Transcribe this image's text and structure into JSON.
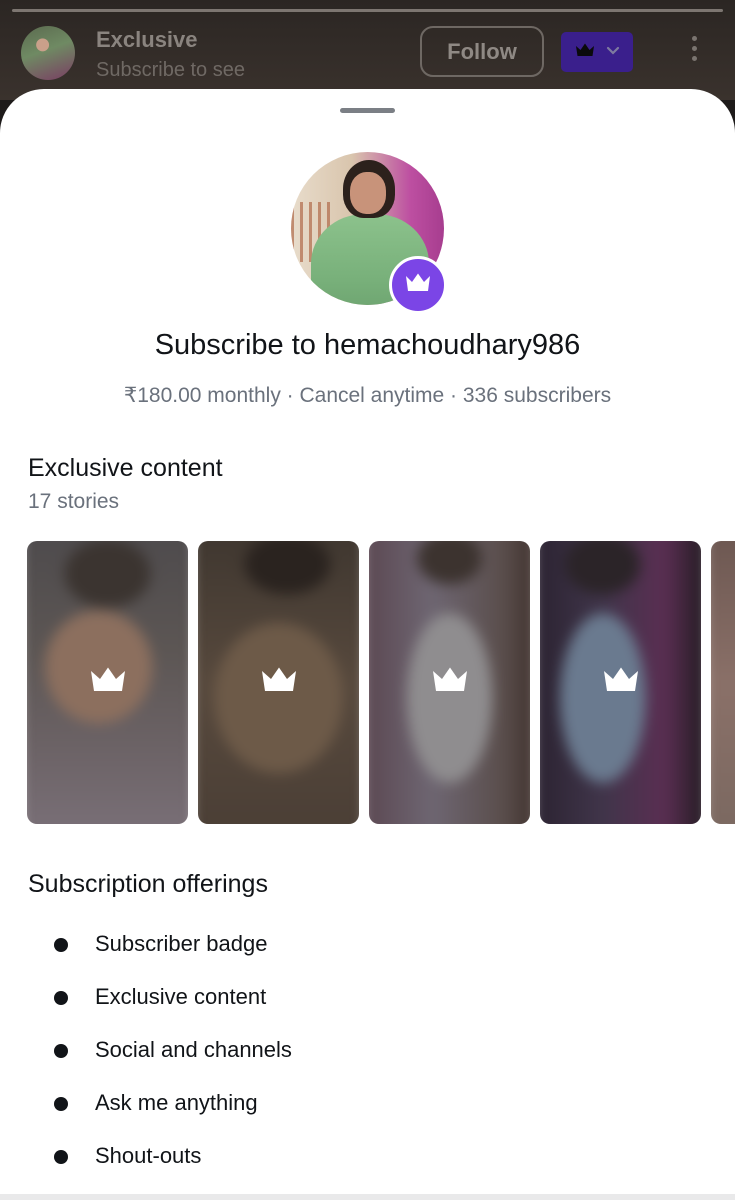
{
  "header": {
    "title": "Exclusive",
    "subtitle": "Subscribe to see",
    "follow_label": "Follow"
  },
  "sheet": {
    "title": "Subscribe to hemachoudhary986",
    "meta": "₹180.00 monthly · Cancel anytime · 336 subscribers",
    "exclusive": {
      "title": "Exclusive content",
      "count": "17 stories"
    },
    "offerings": {
      "title": "Subscription offerings",
      "items": [
        "Subscriber badge",
        "Exclusive content",
        "Social and channels",
        "Ask me anything",
        "Shout-outs"
      ]
    }
  },
  "colors": {
    "accent_purple": "#7b45e6",
    "subscribe_pill": "#3a1f8c",
    "text_primary": "#111418",
    "text_secondary": "#6a717c"
  },
  "icons": {
    "subscriber": "crown-icon",
    "dropdown": "chevron-down-icon",
    "more": "more-vertical-icon",
    "list_bullet": "bullet-icon"
  }
}
